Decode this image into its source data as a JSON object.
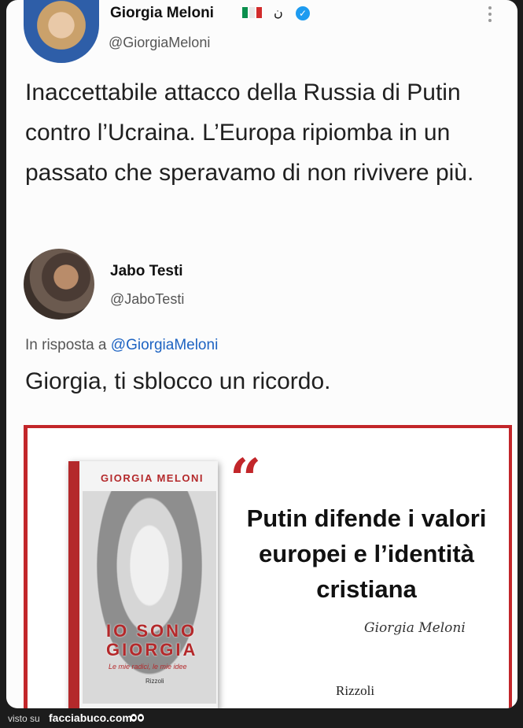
{
  "tweet": {
    "author": {
      "name": "Giorgia Meloni",
      "handle": "@GiorgiaMeloni",
      "extra_glyph": "ن",
      "flag_colors": [
        "#0a8f4d",
        "#ffffff",
        "#d22b2b"
      ]
    },
    "text": "Inaccettabile attacco della Russia di Putin contro l’Ucraina. L’Europa ripiomba in un passato che speravamo di non rivivere più."
  },
  "reply": {
    "author": {
      "name": "Jabo Testi",
      "handle": "@JaboTesti"
    },
    "in_reply_prefix": "In risposta a",
    "in_reply_mention": "@GiorgiaMeloni",
    "text": "Giorgia, ti sblocco un ricordo."
  },
  "media": {
    "book_author": "GIORGIA MELONI",
    "book_title_line1": "IO SONO",
    "book_title_line2": "GIORGIA",
    "book_subtitle": "Le mie radici, le mie idee",
    "book_publisher": "Rizzoli",
    "quote_mark": "“",
    "quote": "Putin difende i valori europei e l’identità cristiana",
    "signature": "Giorgia Meloni",
    "publisher": "Rizzoli"
  },
  "footer": {
    "prefix": "visto su",
    "site": "facciabuco.com"
  },
  "colors": {
    "accent_red": "#c2262a",
    "verified_blue": "#1d9bf0",
    "mention_blue": "#1d63c2"
  }
}
